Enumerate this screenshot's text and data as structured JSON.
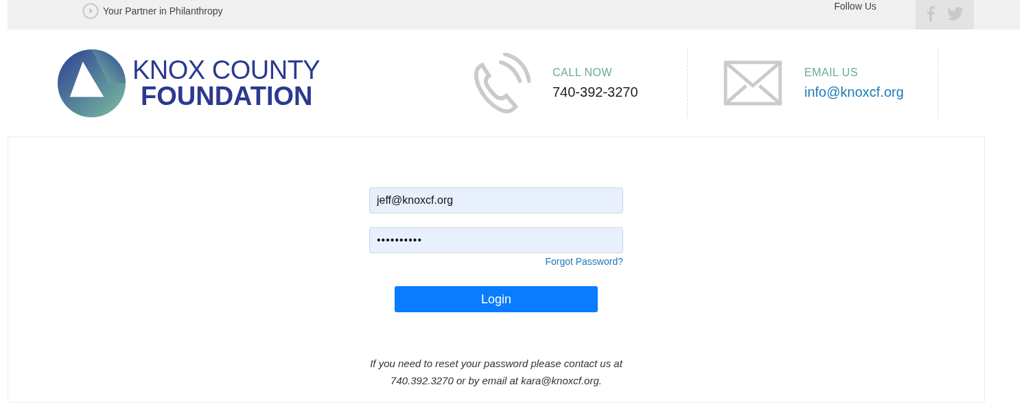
{
  "top_bar": {
    "tagline": "Your Partner in Philanthropy",
    "follow_label": "Follow Us"
  },
  "logo": {
    "line_1": "KNOX COUNTY",
    "line_2": "FOUNDATION"
  },
  "contacts": [
    {
      "kind": "phone",
      "label": "CALL NOW",
      "value": "740-392-3270"
    },
    {
      "kind": "email",
      "label": "EMAIL US",
      "value": "info@knoxcf.org"
    }
  ],
  "login_form": {
    "email": {
      "value": "jeff@knoxcf.org"
    },
    "password": {
      "value": "••••••••••"
    },
    "forgot_link": "Forgot Password?",
    "login_button": "Login",
    "help_text": "If you need to reset your password please contact us at 740.392.3270 or by email at kara@knoxcf.org."
  }
}
